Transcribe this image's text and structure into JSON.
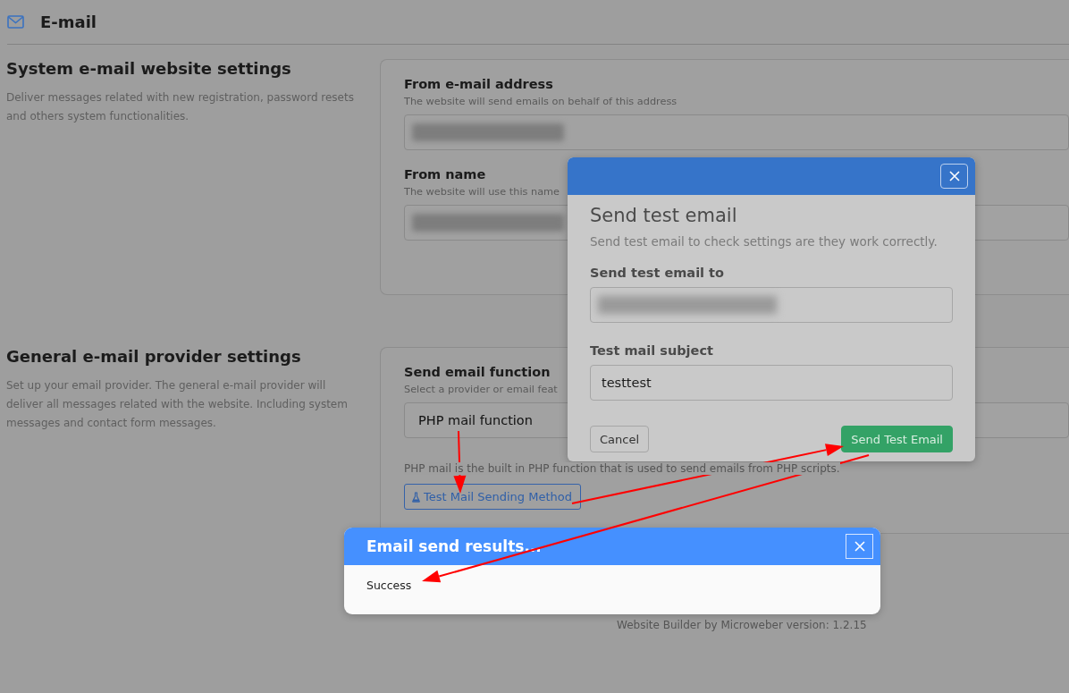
{
  "header": {
    "title": "E-mail"
  },
  "sections": [
    {
      "title": "System e-mail website settings",
      "description": "Deliver messages related with new registration, password resets and others system functionalities.",
      "fields": [
        {
          "kind": "input",
          "label": "From e-mail address",
          "hint": "The website will send emails on behalf of this address",
          "redacted": true
        },
        {
          "kind": "input",
          "label": "From name",
          "hint": "The website will use this name",
          "redacted": true
        }
      ]
    },
    {
      "title": "General e-mail provider settings",
      "description": "Set up your email provider. The general e-mail provider will deliver all messages related with the website. Including system messages and contact form messages.",
      "fields": [
        {
          "kind": "select",
          "label": "Send email function",
          "hint": "Select a provider or email feat",
          "value": "PHP mail function",
          "note": "PHP mail is the built in PHP function that is used to send emails from PHP scripts.",
          "button": "Test Mail Sending Method"
        }
      ]
    }
  ],
  "footer": "Website Builder by Microweber version: 1.2.15",
  "test_modal": {
    "title": "Send test email",
    "subtitle": "Send test email to check settings are they work correctly.",
    "fields": [
      {
        "label": "Send test email to",
        "redacted": true
      },
      {
        "label": "Test mail subject",
        "value": "testtest"
      }
    ],
    "buttons": [
      {
        "kind": "secondary",
        "label": "Cancel"
      },
      {
        "kind": "primary",
        "label": "Send Test Email"
      }
    ]
  },
  "results_dialog": {
    "title": "Email send results...",
    "body": "Success"
  }
}
